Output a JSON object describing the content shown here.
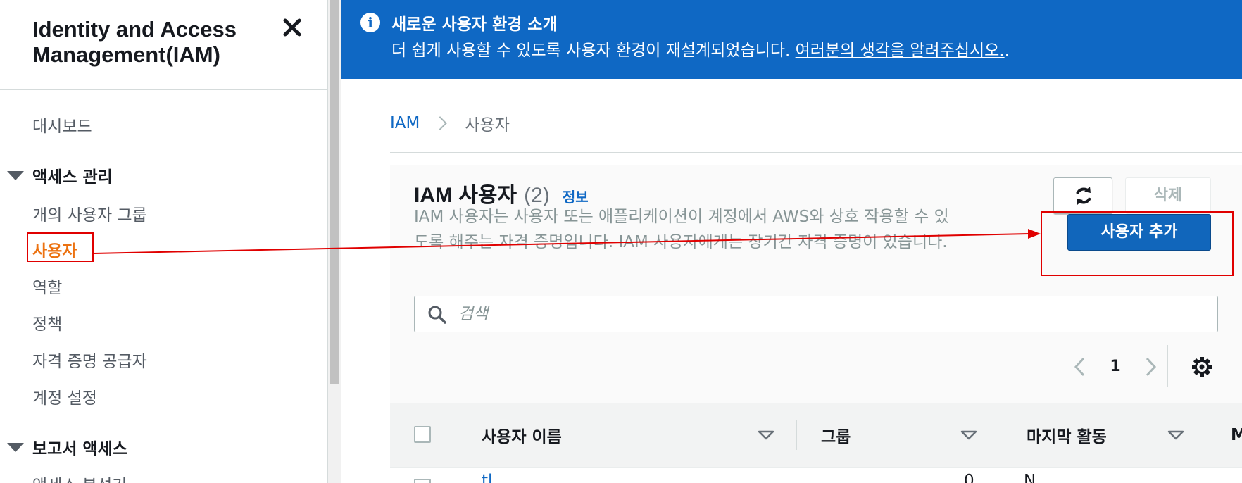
{
  "sidebar": {
    "title": "Identity and Access Management(IAM)",
    "close_icon": "close-icon",
    "dashboard": "대시보드",
    "access_section": "액세스 관리",
    "access_items": [
      "개의 사용자 그룹",
      "사용자",
      "역할",
      "정책",
      "자격 증명 공급자",
      "계정 설정"
    ],
    "reports_section": "보고서 액세스",
    "reports_items": [
      "액세스 분석기"
    ]
  },
  "banner": {
    "icon": "info-icon",
    "title": "새로운 사용자 환경 소개",
    "text": "더 쉽게 사용할 수 있도록 사용자 환경이 재설계되었습니다. ",
    "link": "여러분의 생각을 알려주십시오.",
    "link_suffix": "."
  },
  "breadcrumb": {
    "root": "IAM",
    "current": "사용자"
  },
  "panel": {
    "title": "IAM 사용자",
    "count": "(2)",
    "info": "정보",
    "description": "IAM 사용자는 사용자 또는 애플리케이션이 계정에서 AWS와 상호 작용할 수 있도록 해주는 자격 증명입니다. IAM 사용자에게는 장기간 자격 증명이 있습니다.",
    "refresh_icon": "refresh-icon",
    "delete_label": "삭제",
    "add_label": "사용자 추가",
    "search_placeholder": "검색",
    "page_number": "1"
  },
  "table": {
    "columns": [
      "사용자 이름",
      "그룹",
      "마지막 활동",
      "M"
    ],
    "rows": [
      {
        "user": "tl",
        "group": "0",
        "last": "N"
      }
    ]
  },
  "colors": {
    "banner": "#0f68c4",
    "primary_button": "#1166bb",
    "active_nav": "#ec7211",
    "annotation": "#e00000"
  }
}
